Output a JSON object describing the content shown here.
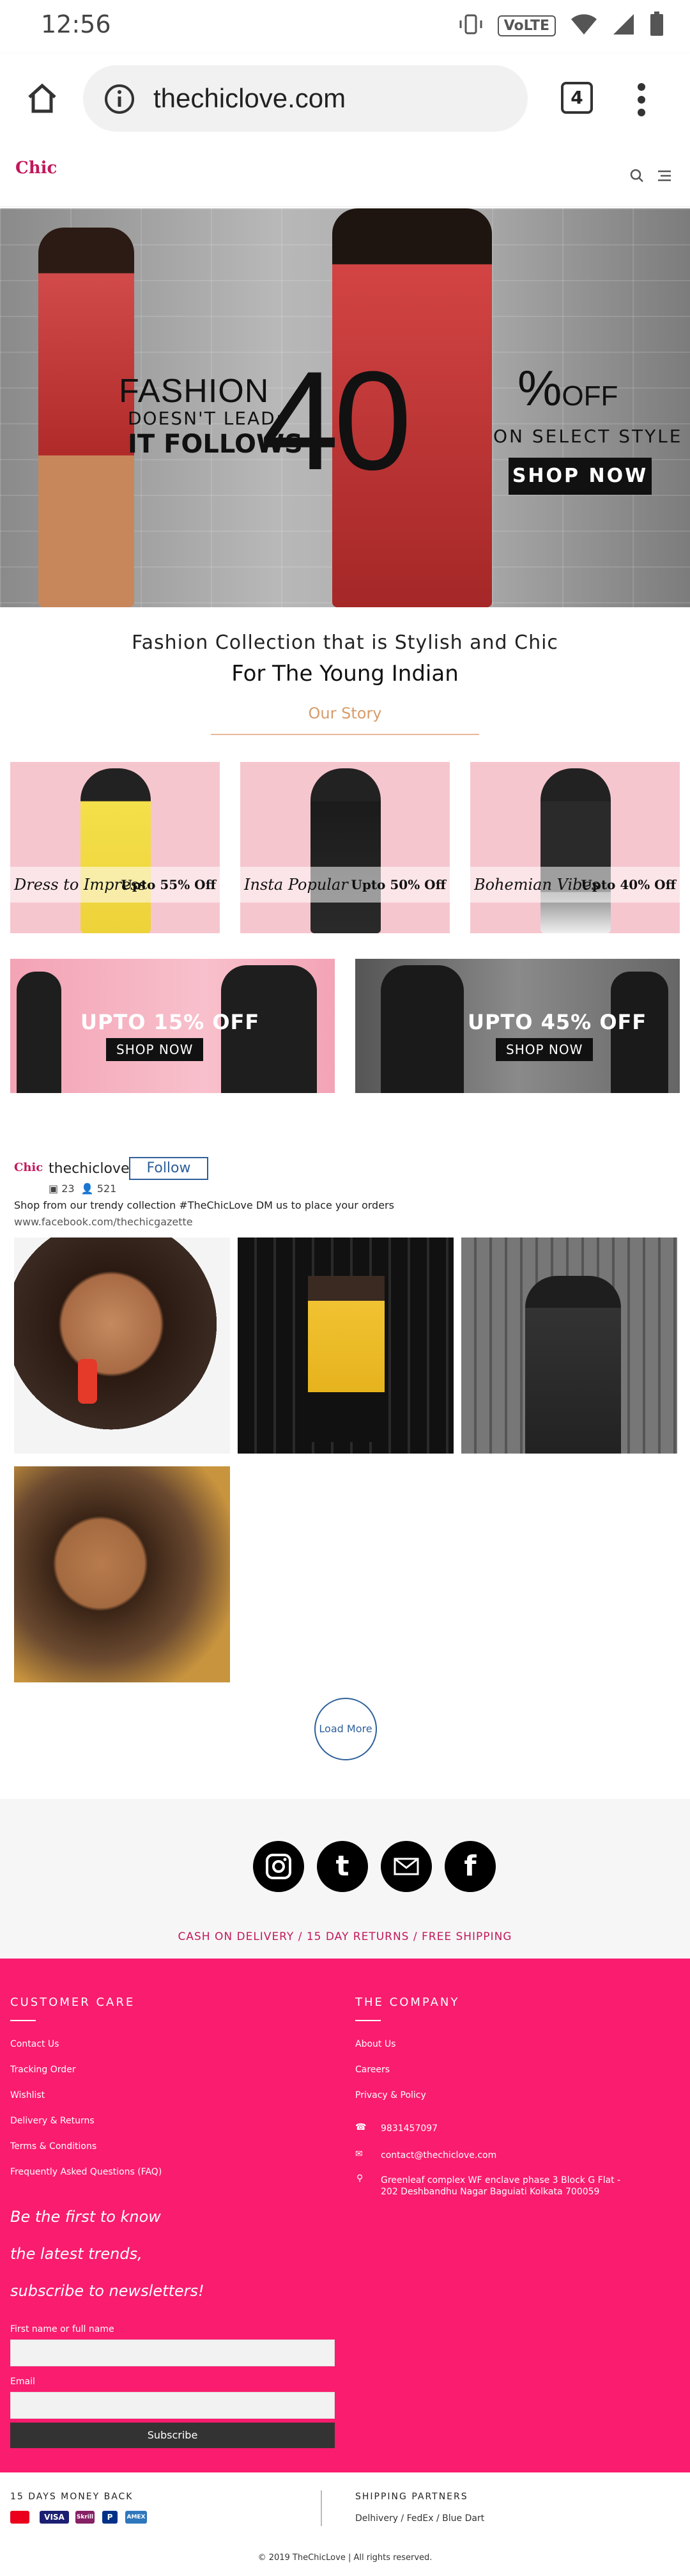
{
  "status_bar": {
    "time": "12:56",
    "volte": "VoLTE"
  },
  "browser": {
    "url": "thechiclove.com",
    "tab_count": "4"
  },
  "site": {
    "logo": "Chic"
  },
  "hero": {
    "line1": "FASHION",
    "line2": "DOESN'T LEAD;",
    "line3": "IT FOLLOWS",
    "number": "40",
    "percent": "%",
    "off": "OFF",
    "select": "ON SELECT STYLE",
    "button": "SHOP NOW"
  },
  "tagline": {
    "line1": "Fashion Collection that is Stylish and Chic",
    "line2": "For The Young Indian",
    "story": "Our Story"
  },
  "categories": [
    {
      "name": "Dress to Impress",
      "offer": "Upto 55% Off",
      "color": "#f4e04a"
    },
    {
      "name": "Insta Popular",
      "offer": "Upto 50% Off",
      "color": "#1b1b1b"
    },
    {
      "name": "Bohemian Vibes",
      "offer": "Upto 40% Off",
      "color": "#2a2a2a"
    }
  ],
  "banners": [
    {
      "text": "UPTO 15% OFF",
      "button": "SHOP NOW"
    },
    {
      "text": "UPTO 45% OFF",
      "button": "SHOP NOW"
    }
  ],
  "instagram": {
    "logo": "Chic",
    "username": "thechiclove",
    "follow": "Follow",
    "posts": "23",
    "followers": "521",
    "description": "Shop from our trendy collection #TheChicLove DM us to place your orders",
    "link": "www.facebook.com/thechicgazette",
    "load_more": "Load More"
  },
  "social": {
    "perks": "CASH ON DELIVERY / 15 DAY RETURNS / FREE SHIPPING"
  },
  "footer": {
    "customer_care": {
      "title": "CUSTOMER CARE",
      "links": [
        "Contact Us",
        "Tracking Order",
        "Wishlist",
        "Delivery & Returns",
        "Terms & Conditions",
        "Frequently Asked Questions (FAQ)"
      ]
    },
    "company": {
      "title": "THE COMPANY",
      "links": [
        "About Us",
        "Careers",
        "Privacy & Policy"
      ],
      "phone": "9831457097",
      "email": "contact@thechiclove.com",
      "address": "Greenleaf complex WF enclave phase 3 Block G Flat - 202 Deshbandhu Nagar Baguiati Kolkata 700059"
    },
    "newsletter": {
      "line1": "Be the first to know",
      "line2": "the latest trends,",
      "line3": "subscribe to newsletters!",
      "name_label": "First name or full name",
      "email_label": "Email",
      "submit": "Subscribe"
    }
  },
  "bottom": {
    "money_back": "15 DAYS MONEY BACK",
    "shipping_title": "SHIPPING PARTNERS",
    "shipping": "Delhivery / FedEx / Blue Dart",
    "payments": [
      "VISA",
      "Skrill",
      "P",
      "AMEX"
    ],
    "copyright": "© 2019 TheChicLove | All rights reserved."
  }
}
